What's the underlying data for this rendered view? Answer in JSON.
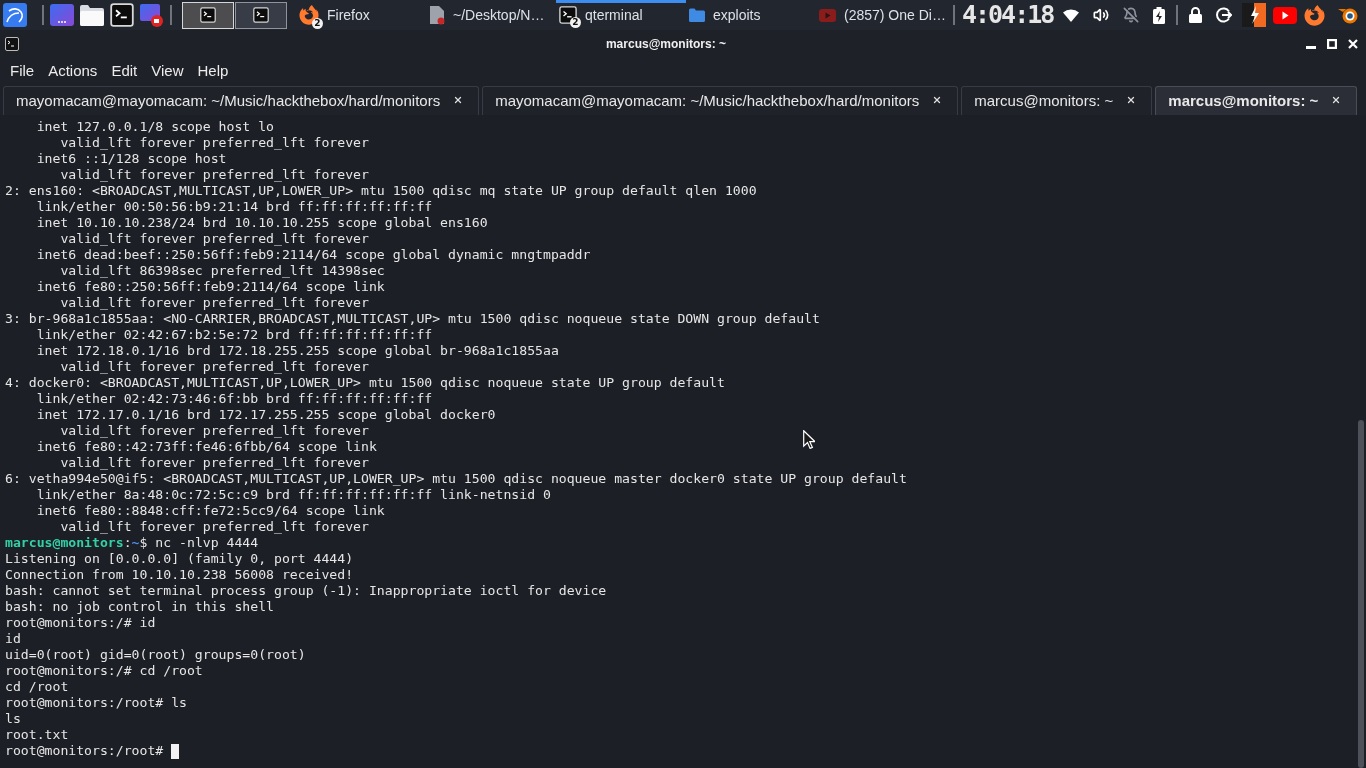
{
  "taskbar": {
    "workspaces": [
      {
        "selected": true
      },
      {
        "selected": false
      }
    ],
    "tasks": [
      {
        "kind": "firefox",
        "label": "Firefox",
        "badge": "2",
        "selected": false
      },
      {
        "kind": "document",
        "label": "~/Desktop/N…",
        "selected": false
      },
      {
        "kind": "terminal",
        "label": "qterminal",
        "badge": "2",
        "selected": true
      },
      {
        "kind": "folder",
        "label": "exploits",
        "selected": false
      },
      {
        "kind": "video",
        "label": "(2857) One Di…",
        "selected": false
      }
    ],
    "clock": "4:04:18"
  },
  "window": {
    "title": "marcus@monitors: ~",
    "menu": [
      "File",
      "Actions",
      "Edit",
      "View",
      "Help"
    ],
    "tabs": [
      {
        "label": "mayomacam@mayomacam: ~/Music/hackthebox/hard/monitors",
        "selected": false
      },
      {
        "label": "mayomacam@mayomacam: ~/Music/hackthebox/hard/monitors",
        "selected": false
      },
      {
        "label": "marcus@monitors: ~",
        "selected": false
      },
      {
        "label": "marcus@monitors: ~",
        "selected": true
      }
    ],
    "terminal": {
      "lines": [
        {
          "kind": "output",
          "children": [
            {
              "text": "inet 127.0.0.1/8 scope host lo",
              "children": [
                {
                  "text": "valid_lft forever preferred_lft forever"
                }
              ]
            },
            {
              "text": "inet6 ::1/128 scope host",
              "children": [
                {
                  "text": "valid_lft forever preferred_lft forever"
                }
              ]
            }
          ]
        },
        {
          "kind": "output",
          "text": "2: ens160: <BROADCAST,MULTICAST,UP,LOWER_UP> mtu 1500 qdisc mq state UP group default qlen 1000",
          "children": [
            {
              "text": "link/ether 00:50:56:b9:21:14 brd ff:ff:ff:ff:ff:ff"
            },
            {
              "text": "inet 10.10.10.238/24 brd 10.10.10.255 scope global ens160",
              "children": [
                {
                  "text": "valid_lft forever preferred_lft forever"
                }
              ]
            },
            {
              "text": "inet6 dead:beef::250:56ff:feb9:2114/64 scope global dynamic mngtmpaddr",
              "children": [
                {
                  "text": "valid_lft 86398sec preferred_lft 14398sec"
                }
              ]
            },
            {
              "text": "inet6 fe80::250:56ff:feb9:2114/64 scope link",
              "children": [
                {
                  "text": "valid_lft forever preferred_lft forever"
                }
              ]
            }
          ]
        },
        {
          "kind": "output",
          "text": "3: br-968a1c1855aa: <NO-CARRIER,BROADCAST,MULTICAST,UP> mtu 1500 qdisc noqueue state DOWN group default",
          "children": [
            {
              "text": "link/ether 02:42:67:b2:5e:72 brd ff:ff:ff:ff:ff:ff"
            },
            {
              "text": "inet 172.18.0.1/16 brd 172.18.255.255 scope global br-968a1c1855aa",
              "children": [
                {
                  "text": "valid_lft forever preferred_lft forever"
                }
              ]
            }
          ]
        },
        {
          "kind": "output",
          "text": "4: docker0: <BROADCAST,MULTICAST,UP,LOWER_UP> mtu 1500 qdisc noqueue state UP group default",
          "children": [
            {
              "text": "link/ether 02:42:73:46:6f:bb brd ff:ff:ff:ff:ff:ff"
            },
            {
              "text": "inet 172.17.0.1/16 brd 172.17.255.255 scope global docker0",
              "children": [
                {
                  "text": "valid_lft forever preferred_lft forever"
                }
              ]
            },
            {
              "text": "inet6 fe80::42:73ff:fe46:6fbb/64 scope link",
              "children": [
                {
                  "text": "valid_lft forever preferred_lft forever"
                }
              ]
            }
          ]
        },
        {
          "kind": "output",
          "text": "6: vetha994e50@if5: <BROADCAST,MULTICAST,UP,LOWER_UP> mtu 1500 qdisc noqueue master docker0 state UP group default",
          "children": [
            {
              "text": "link/ether 8a:48:0c:72:5c:c9 brd ff:ff:ff:ff:ff:ff link-netnsid 0"
            },
            {
              "text": "inet6 fe80::8848:cff:fe72:5cc9/64 scope link",
              "children": [
                {
                  "text": "valid_lft forever preferred_lft forever"
                }
              ]
            }
          ]
        },
        {
          "kind": "prompt",
          "segments": [
            {
              "kind": "user",
              "text": "marcus@monitors"
            },
            {
              "kind": "plain",
              "text": ":"
            },
            {
              "kind": "path",
              "text": "~"
            },
            {
              "kind": "plain",
              "text": "$ nc -nlvp 4444"
            }
          ]
        },
        {
          "kind": "output",
          "text": "Listening on [0.0.0.0] (family 0, port 4444)"
        },
        {
          "kind": "output",
          "text": "Connection from 10.10.10.238 56008 received!"
        },
        {
          "kind": "output",
          "text": "bash: cannot set terminal process group (-1): Inappropriate ioctl for device"
        },
        {
          "kind": "output",
          "text": "bash: no job control in this shell"
        },
        {
          "kind": "output",
          "text": "root@monitors:/# id"
        },
        {
          "kind": "output",
          "text": "id"
        },
        {
          "kind": "output",
          "text": "uid=0(root) gid=0(root) groups=0(root)"
        },
        {
          "kind": "output",
          "text": "root@monitors:/# cd /root"
        },
        {
          "kind": "output",
          "text": "cd /root"
        },
        {
          "kind": "output",
          "text": "root@monitors:/root# ls"
        },
        {
          "kind": "output",
          "text": "ls"
        },
        {
          "kind": "output",
          "text": "root.txt"
        },
        {
          "kind": "output",
          "text": "root@monitors:/root#",
          "cursor": true
        }
      ]
    }
  }
}
